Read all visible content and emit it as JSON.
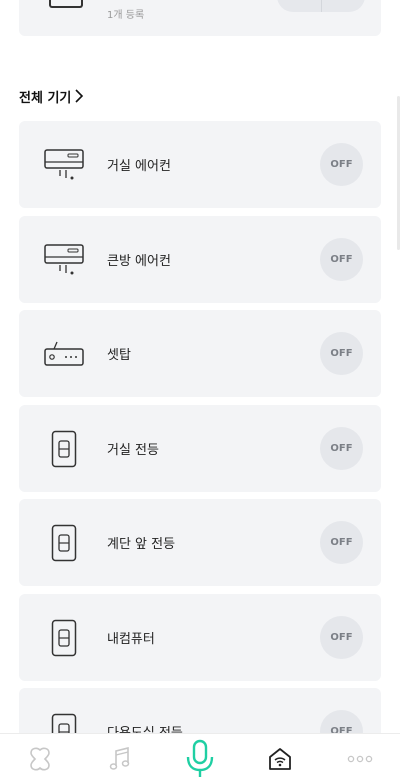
{
  "top_card": {
    "sub_text": "1개 등록"
  },
  "section": {
    "title": "전체 기기"
  },
  "devices": [
    {
      "name": "거실 에어컨",
      "icon": "air-conditioner-icon",
      "status": "OFF"
    },
    {
      "name": "큰방 에어컨",
      "icon": "air-conditioner-icon",
      "status": "OFF"
    },
    {
      "name": "셋탑",
      "icon": "settop-box-icon",
      "status": "OFF"
    },
    {
      "name": "거실 전등",
      "icon": "light-switch-icon",
      "status": "OFF"
    },
    {
      "name": "계단 앞 전등",
      "icon": "light-switch-icon",
      "status": "OFF"
    },
    {
      "name": "내컴퓨터",
      "icon": "light-switch-icon",
      "status": "OFF"
    },
    {
      "name": "다용도실 전등",
      "icon": "light-switch-icon",
      "status": "OFF"
    }
  ],
  "bottom_nav": [
    {
      "icon": "clover-icon"
    },
    {
      "icon": "music-note-icon"
    },
    {
      "icon": "microphone-icon",
      "color": "#1fcfa3"
    },
    {
      "icon": "smart-home-icon"
    },
    {
      "icon": "more-dots-icon"
    }
  ]
}
